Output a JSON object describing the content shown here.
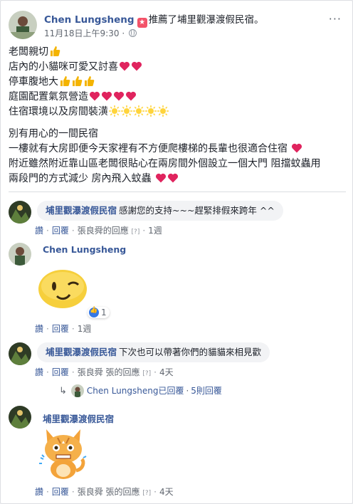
{
  "post": {
    "author": "Chen Lungsheng",
    "action_text": "推薦了埔里觀瀑渡假民宿。",
    "timestamp": "11月18日上午9:30",
    "privacy_icon": "globe-icon",
    "more_label": "···",
    "lines_block1": [
      "老闆親切",
      "店內的小貓咪可愛又討喜",
      "停車腹地大",
      "庭園配置氣氛營造",
      "住宿環境以及房間裝潢"
    ],
    "lines_block2": [
      "別有用心的一間民宿",
      "一樓就有大房即便今天家裡有不方便爬樓梯的長輩也很適合住宿",
      "附近雖然附近靠山區老闆很貼心在兩房間外個設立一個大門 阻擋蚊蟲用",
      "兩段門的方式減少 房內飛入蚊蟲"
    ]
  },
  "comments": [
    {
      "author": "埔里觀瀑渡假民宿",
      "text": "感謝您的支持~~~趕緊排假來跨年 ^^",
      "like": "讚",
      "reply": "回覆",
      "replied_by": "張良舜的回應",
      "qmark": "[?]",
      "time": "1週"
    },
    {
      "author": "Chen Lungsheng",
      "sticker": "winking-face-sticker",
      "reaction_count": "1",
      "like": "讚",
      "reply": "回覆",
      "time": "1週"
    },
    {
      "author": "埔里觀瀑渡假民宿",
      "text": "下次也可以帶著你們的貓貓來相見歡",
      "like": "讚",
      "reply": "回覆",
      "replied_by": "張良舜 張的回應",
      "qmark": "[?]",
      "time": "4天",
      "reply_summary": {
        "name": "Chen Lungsheng已回覆",
        "count": "5則回覆"
      }
    },
    {
      "author": "埔里觀瀑渡假民宿",
      "sticker": "cat-sticker",
      "like": "讚",
      "reply": "回覆",
      "replied_by": "張良舜 張的回應",
      "qmark": "[?]",
      "time": "4天"
    }
  ],
  "colors": {
    "link": "#385898",
    "meta": "#616770",
    "bubble": "#f2f3f5",
    "heart": "#e0245e",
    "thumb": "#f4b400"
  }
}
